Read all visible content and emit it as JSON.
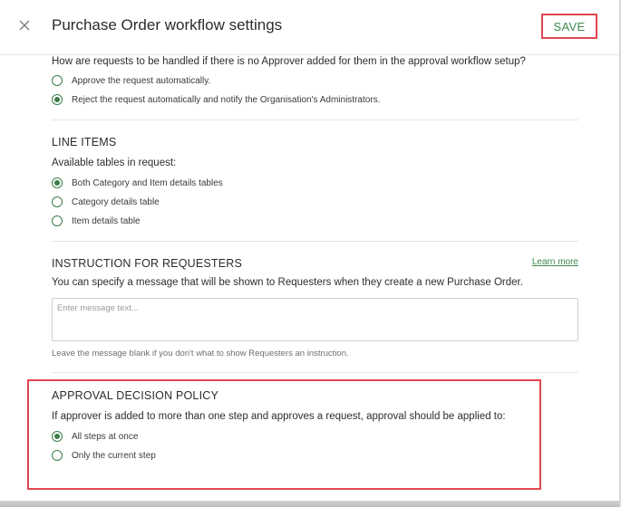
{
  "header": {
    "title": "Purchase Order workflow settings",
    "save_label": "SAVE"
  },
  "no_approver": {
    "question": "How are requests to be handled if there is no Approver added for them in the approval workflow setup?",
    "options": [
      {
        "label": "Approve the request automatically.",
        "selected": false
      },
      {
        "label": "Reject the request automatically and notify the Organisation's Administrators.",
        "selected": true
      }
    ]
  },
  "line_items": {
    "title": "LINE ITEMS",
    "question": "Available tables in request:",
    "options": [
      {
        "label": "Both Category and Item details tables",
        "selected": true
      },
      {
        "label": "Category details table",
        "selected": false
      },
      {
        "label": "Item details table",
        "selected": false
      }
    ]
  },
  "instruction": {
    "title": "INSTRUCTION FOR REQUESTERS",
    "learn_more": "Learn more",
    "description": "You can specify a message that will be shown to Requesters when they create a new Purchase Order.",
    "message_value": "",
    "message_placeholder": "Enter message text...",
    "hint": "Leave the message blank if you don't what to show Requesters an instruction."
  },
  "approval_policy": {
    "title": "APPROVAL DECISION POLICY",
    "question": "If approver is added to more than one step and approves a request, approval should be applied to:",
    "options": [
      {
        "label": "All steps at once",
        "selected": true
      },
      {
        "label": "Only the current step",
        "selected": false
      }
    ]
  },
  "colors": {
    "accent": "#3a7d48",
    "highlight": "#e0464e"
  },
  "icons": {
    "close": "close-icon"
  }
}
